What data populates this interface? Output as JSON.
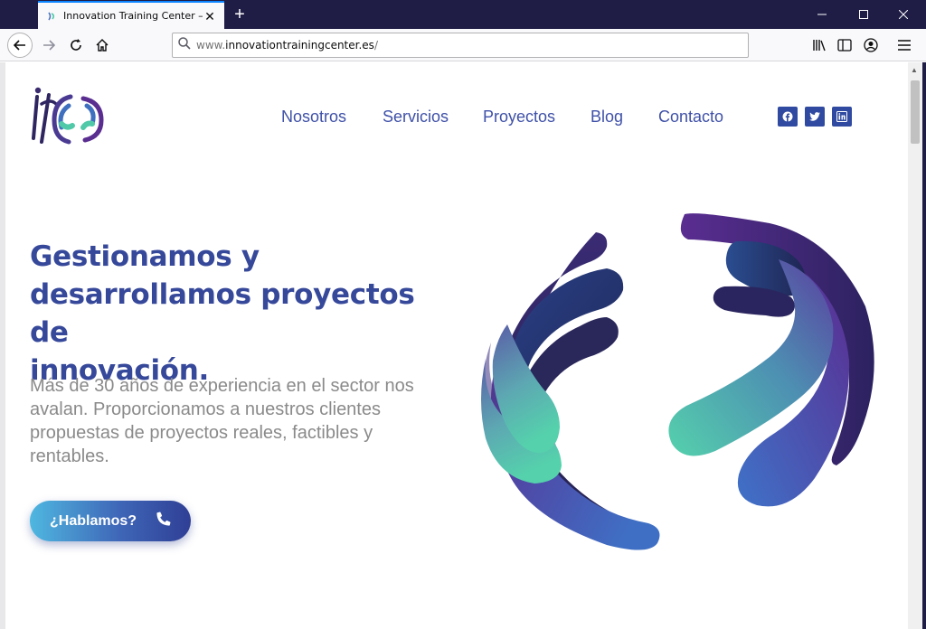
{
  "browser": {
    "tab_title": "Innovation Training Center – Ge",
    "url_host": "www.innovationtrainingcenter.es/",
    "url_prefix": "www.",
    "url_domain": "innovationtrainingcenter.es",
    "url_suffix": "/"
  },
  "nav": {
    "items": [
      {
        "label": "Nosotros"
      },
      {
        "label": "Servicios"
      },
      {
        "label": "Proyectos"
      },
      {
        "label": "Blog"
      },
      {
        "label": "Contacto"
      }
    ],
    "social": [
      "facebook-icon",
      "twitter-icon",
      "linkedin-icon"
    ]
  },
  "hero": {
    "headline_line1": "Gestionamos y",
    "headline_line2": "desarrollamos proyectos de",
    "headline_line3": "innovación.",
    "subtext_line1": "Más de 30 años de experiencia en el sector nos",
    "subtext_line2": "avalan. Proporcionamos a nuestros clientes",
    "subtext_line3": "propuestas de proyectos reales, factibles y",
    "subtext_line4": "rentables.",
    "cta_label": "¿Hablamos?"
  },
  "colors": {
    "brand": "#36489a",
    "accent_teal": "#4fc9a8",
    "accent_purple": "#5a2d91",
    "chrome_dark": "#1f1c45"
  }
}
